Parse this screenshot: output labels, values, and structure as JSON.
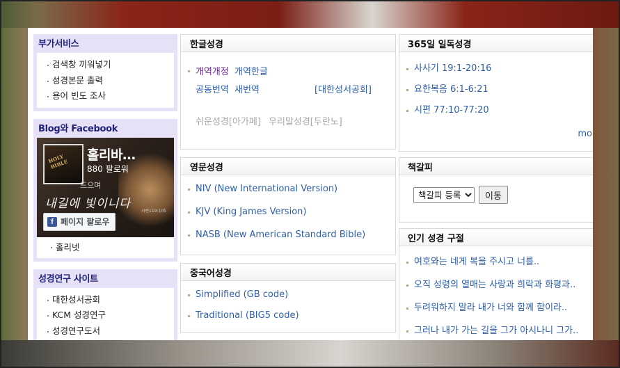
{
  "sidebar": {
    "services": {
      "title": "부가서비스",
      "items": [
        "검색창 끼워넣기",
        "성경본문 출력",
        "용어 빈도 조사"
      ]
    },
    "blog": {
      "title": "Blog와 Facebook",
      "page_name": "홀리바…",
      "followers": "880 팔로워",
      "follow_label": "페이지 팔로우",
      "fb_logo": "f",
      "link": "홀리넷"
    },
    "research": {
      "title": "성경연구 사이트",
      "items": [
        "대한성서공회",
        "KCM 성경연구",
        "성경연구도서"
      ]
    }
  },
  "korean_bible": {
    "title": "한글성경",
    "rev_revised": "개역개정",
    "rev_hangul": "개역한글",
    "common": "공동번역",
    "new": "새번역",
    "society": "[대한성서공회]",
    "easy": "쉬운성경[아가페]",
    "our": "우리말성경[두란노]"
  },
  "english_bible": {
    "title": "영문성경",
    "items": [
      "NIV (New International Version)",
      "KJV (King James Version)",
      "NASB (New American Standard Bible)"
    ]
  },
  "chinese_bible": {
    "title": "중국어성경",
    "items": [
      "Simplified (GB code)",
      "Traditional (BIG5 code)"
    ]
  },
  "yearly": {
    "title": "365일 일독성경",
    "items": [
      "사사기 19:1-20:16",
      "요한복음 6:1-6:21",
      "시편 77:10-77:20"
    ],
    "more": "more"
  },
  "bookmark": {
    "title": "책갈피",
    "select_value": "책갈피 등록",
    "go_label": "이동"
  },
  "popular": {
    "title": "인기 성경 구절",
    "items": [
      "여호와는 네게 복을 주시고 너를..",
      "오직 성령의 열매는 사랑과 희락과 화평과..",
      "두려워하지 말라 내가 너와 함께 함이라..",
      "그러나 내가 가는 길을 그가 아시나니 그가.."
    ]
  },
  "colors": {
    "link_blue": "#2f5fa8",
    "sidebar_title": "#22237a",
    "sidebar_bg": "#e6e1f7",
    "disabled_gray": "#a8a8a8"
  }
}
